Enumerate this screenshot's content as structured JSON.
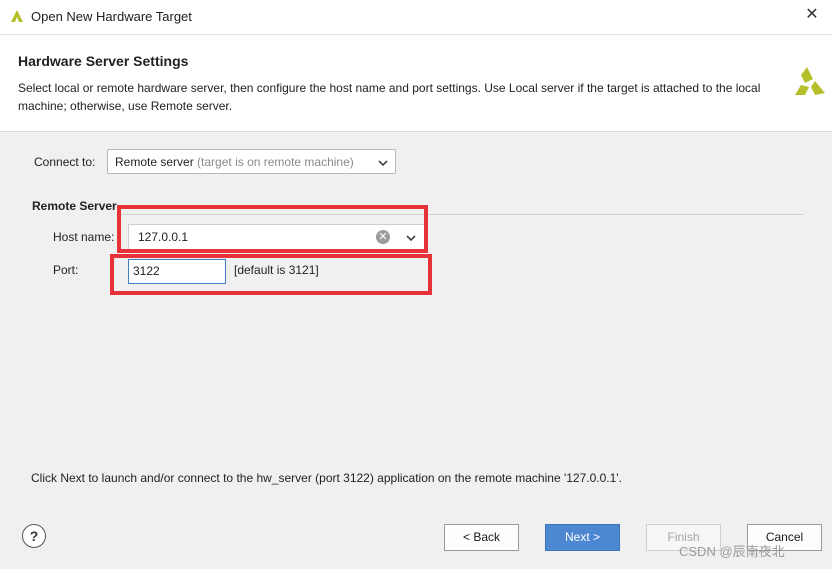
{
  "window": {
    "title": "Open New Hardware Target"
  },
  "header": {
    "title": "Hardware Server Settings",
    "description": "Select local or remote hardware server, then configure the host name and port settings. Use Local server if the target is attached to the local machine; otherwise, use Remote server."
  },
  "connect": {
    "label": "Connect to:",
    "selected": "Remote server",
    "hint": "(target is on remote machine)"
  },
  "remote": {
    "section_title": "Remote Server",
    "host_label": "Host name:",
    "host_value": "127.0.0.1",
    "port_label": "Port:",
    "port_value": "3122",
    "port_default": "[default is 3121]"
  },
  "footer": {
    "note": "Click Next to launch and/or connect to the hw_server (port 3122) application on the remote machine '127.0.0.1'."
  },
  "buttons": {
    "help": "?",
    "back": "< Back",
    "next": "Next >",
    "finish": "Finish",
    "cancel": "Cancel"
  },
  "watermark": "CSDN @辰南夜北",
  "colors": {
    "accent": "#4d86d1",
    "highlight": "#e8323a",
    "logo": "#b5bf2a"
  }
}
